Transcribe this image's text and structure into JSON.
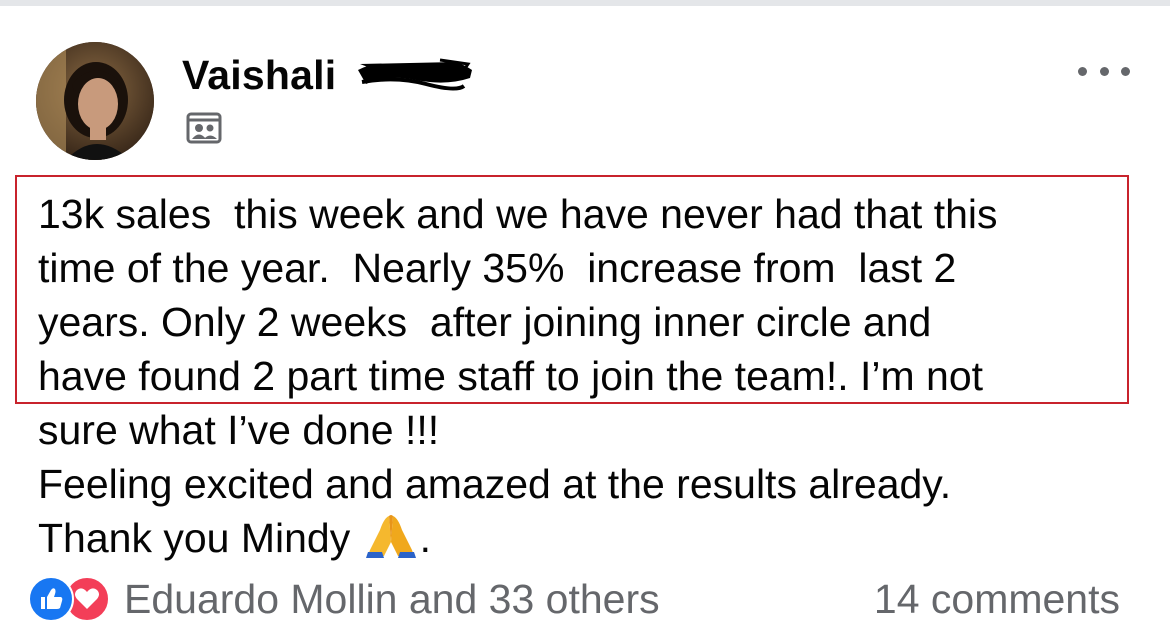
{
  "post": {
    "author": {
      "name": "Vaishali",
      "name_redacted": true
    },
    "audience_icon": "group-audience-icon",
    "more_icon": "more-options-icon",
    "text_lines": [
      "13k sales  this week and we have never had that this",
      "time of the year.  Nearly 35%  increase from  last 2",
      "years. Only 2 weeks  after joining inner circle and",
      "have found 2 part time staff to join the team!. I’m not",
      "sure what I’ve done !!!",
      "Feeling excited and amazed at the results already.",
      "Thank you Mindy"
    ],
    "final_line_suffix": ".",
    "final_emoji": "folded-hands-icon",
    "highlight_color": "#c8232c"
  },
  "footer": {
    "reaction_icons": [
      "like-icon",
      "love-icon"
    ],
    "reactors_text": "Eduardo Mollin and 33 others",
    "comments_text": "14 comments"
  },
  "colors": {
    "like": "#1877f2",
    "love": "#f33e58",
    "secondary_text": "#65676b"
  }
}
